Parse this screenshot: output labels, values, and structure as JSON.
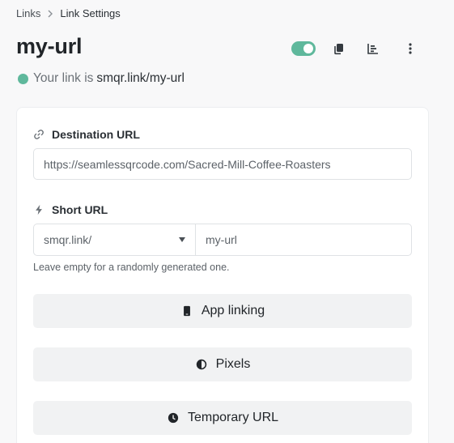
{
  "breadcrumb": {
    "root": "Links",
    "current": "Link Settings"
  },
  "header": {
    "title": "my-url",
    "toggle_on": true
  },
  "status": {
    "prefix": "Your link is",
    "url": "smqr.link/my-url",
    "color": "#5fb89c"
  },
  "form": {
    "destination": {
      "label": "Destination URL",
      "value": "https://seamlessqrcode.com/Sacred-Mill-Coffee-Roasters"
    },
    "short_url": {
      "label": "Short URL",
      "domain_selected": "smqr.link/",
      "value": "my-url",
      "hint": "Leave empty for a randomly generated one."
    },
    "buttons": {
      "app_linking": "App linking",
      "pixels": "Pixels",
      "temporary_url": "Temporary URL"
    }
  },
  "icons": {
    "toggle": "toggle-switch",
    "copy": "copy-icon",
    "stats": "bar-chart-icon",
    "more": "vertical-dots-icon",
    "destination": "link-icon",
    "short": "bolt-icon",
    "app_linking": "mobile-phone-icon",
    "pixels": "adjust-contrast-icon",
    "temporary_url": "clock-icon"
  }
}
